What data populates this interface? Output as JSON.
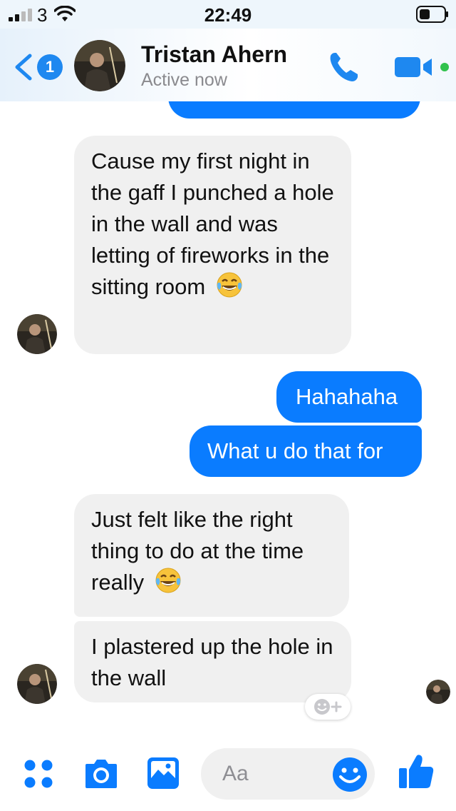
{
  "status_bar": {
    "carrier": "3",
    "time": "22:49"
  },
  "header": {
    "back_badge": "1",
    "contact_name": "Tristan Ahern",
    "contact_status": "Active now"
  },
  "messages": [
    {
      "from": "them",
      "text": "Cause my first night in the gaff I punched a hole in the wall and was letting of fireworks in the sitting room",
      "emoji": "tears-of-joy"
    },
    {
      "from": "me",
      "text": "Hahahaha"
    },
    {
      "from": "me",
      "text": "What u do that for"
    },
    {
      "from": "them",
      "text": "Just felt like the right thing to do at the time really",
      "emoji": "tears-of-joy"
    },
    {
      "from": "them",
      "text": "I plastered up the hole in the wall"
    }
  ],
  "composer": {
    "placeholder": "Aa"
  },
  "colors": {
    "accent": "#0a7cff",
    "incoming_bubble": "#f0f0f0",
    "header_bg": "#eef6fc",
    "active_dot": "#31c24d"
  },
  "icons": [
    "signal-icon",
    "wifi-icon",
    "battery-icon",
    "back-chevron-icon",
    "phone-icon",
    "video-camera-icon",
    "menu-dots-icon",
    "camera-icon",
    "gallery-icon",
    "smiley-icon",
    "thumbs-up-icon",
    "tears-of-joy-emoji",
    "add-reaction-icon"
  ]
}
